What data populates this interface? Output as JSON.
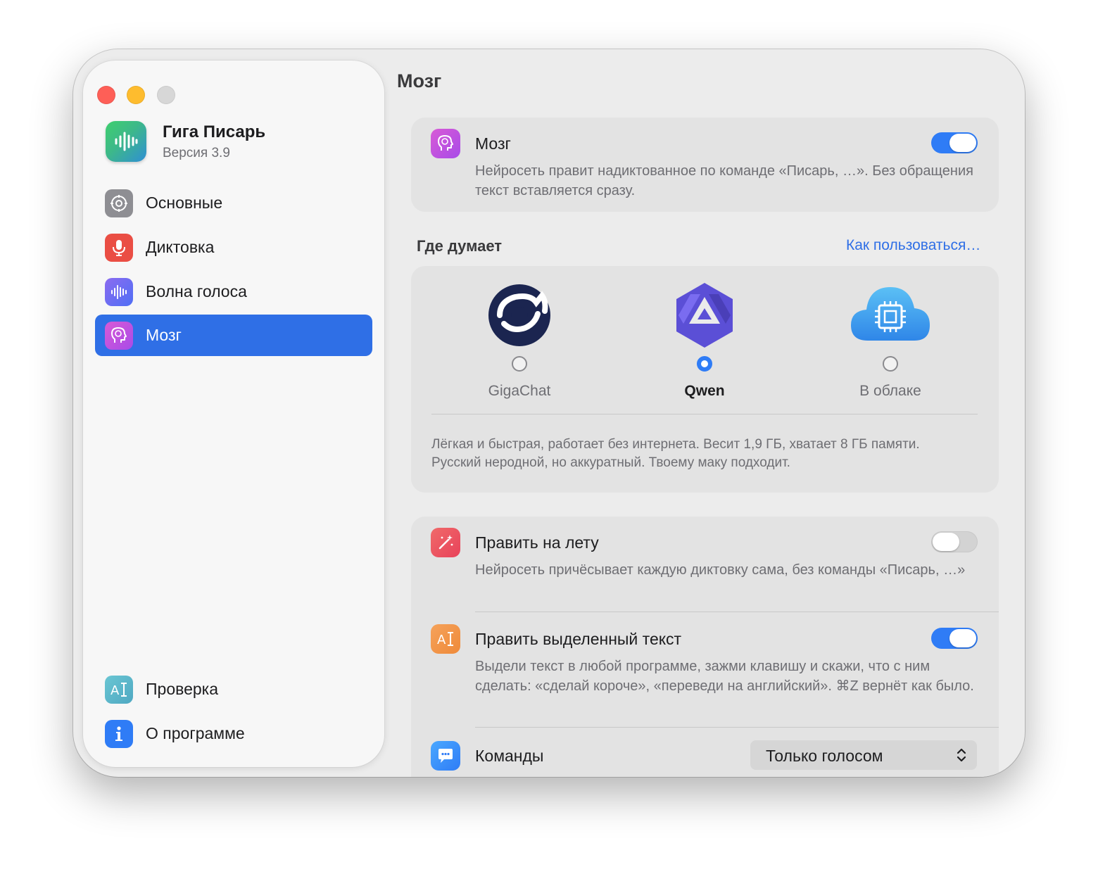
{
  "window": {
    "traffic_lights": [
      "close",
      "minimize",
      "zoom"
    ]
  },
  "app": {
    "name": "Гига Писарь",
    "version": "Версия 3.9",
    "icon": "waveform-icon"
  },
  "sidebar": {
    "items": [
      {
        "label": "Основные",
        "icon": "gear-icon",
        "color": "#8e8e93",
        "active": false
      },
      {
        "label": "Диктовка",
        "icon": "microphone-icon",
        "color": "#ea4e44",
        "active": false
      },
      {
        "label": "Волна голоса",
        "icon": "waveform-icon",
        "color": "#6b6ef0",
        "active": false
      },
      {
        "label": "Мозг",
        "icon": "brain-head-icon",
        "color": "#c94fe0",
        "active": true
      }
    ],
    "bottom_items": [
      {
        "label": "Проверка",
        "icon": "text-cursor-icon",
        "color": "#5bb8c9"
      },
      {
        "label": "О программе",
        "icon": "info-icon",
        "color": "#2f7cf6"
      }
    ]
  },
  "main": {
    "title": "Мозг",
    "brain_card": {
      "title": "Мозг",
      "description": "Нейросеть правит надиктованное по команде «Писарь, …». Без обращения текст вставляется сразу.",
      "toggle_on": true
    },
    "where_thinks": {
      "title": "Где думает",
      "link": "Как пользоваться…",
      "options": [
        {
          "label": "GigaChat",
          "logo": "gigachat-logo-icon",
          "selected": false
        },
        {
          "label": "Qwen",
          "logo": "qwen-logo-icon",
          "selected": true
        },
        {
          "label": "В облаке",
          "logo": "cloud-chip-icon",
          "selected": false
        }
      ],
      "description": "Лёгкая и быстрая, работает без интернета. Весит 1,9 ГБ, хватает 8 ГБ памяти. Русский неродной, но аккуратный. Твоему маку подходит."
    },
    "settings": [
      {
        "title": "Править на лету",
        "description": "Нейросеть причёсывает каждую диктовку сама, без команды «Писарь, …»",
        "icon": "magic-wand-icon",
        "toggle_on": false
      },
      {
        "title": "Править выделенный текст",
        "description": "Выдели текст в любой программе, зажми клавишу и скажи, что с ним сделать: «сделай короче», «переведи на английский». ⌘Z вернёт как было.",
        "icon": "text-cursor-icon",
        "toggle_on": true
      },
      {
        "title": "Команды",
        "icon": "chat-bubble-icon",
        "select_value": "Только голосом"
      }
    ]
  },
  "colors": {
    "accent": "#2f7cf6",
    "sidebar_active": "#2f6fe6",
    "link": "#2f6fe6"
  }
}
